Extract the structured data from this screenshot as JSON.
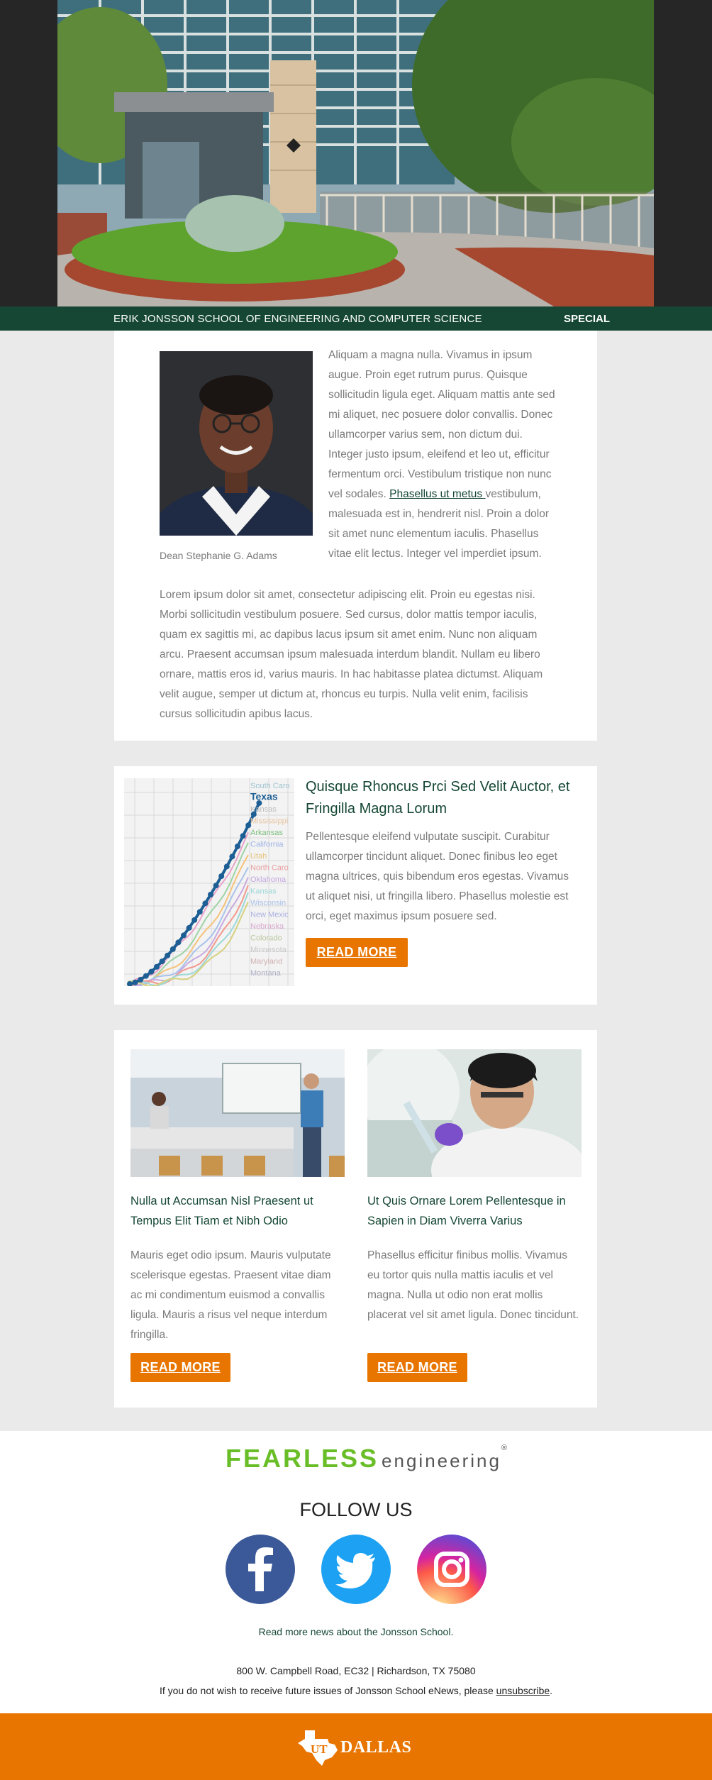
{
  "header": {
    "school_name": "ERIK JONSSON SCHOOL OF ENGINEERING AND COMPUTER SCIENCE",
    "edition_label": "SPECIAL"
  },
  "dean_section": {
    "caption": "Dean Stephanie G. Adams",
    "para1_before_link": "Aliquam a magna nulla. Vivamus in ipsum augue. Proin eget rutrum purus. Quisque sollicitudin ligula eget. Aliquam mattis ante sed mi aliquet, nec posuere dolor convallis. Donec ullamcorper varius sem, non dictum dui. Integer justo ipsum, eleifend et leo ut, efficitur fermentum orci. Vestibulum tristique non nunc vel sodales.",
    "link_text": "Phasellus ut metus ",
    "para1_after_link": "vestibulum, malesuada est in, hendrerit nisl. Proin a dolor sit amet nunc elementum iaculis. Phasellus vitae elit lectus. Integer vel imperdiet ipsum.",
    "para2": "Lorem ipsum dolor sit amet, consectetur adipiscing elit. Proin eu egestas nisi. Morbi sollicitudin vestibulum posuere. Sed cursus, dolor mattis tempor iaculis, quam ex sagittis mi, ac dapibus lacus ipsum sit amet enim. Nunc non aliquam arcu. Praesent accumsan ipsum malesuada interdum blandit. Nullam eu libero ornare, mattis eros id, varius mauris. In hac habitasse platea dictumst. Aliquam velit augue, semper ut dictum at, rhoncus eu turpis. Nulla velit enim, facilisis cursus sollicitudin apibus lacus."
  },
  "feature": {
    "title": "Quisque Rhoncus Prci Sed Velit Auctor, et Fringilla Magna Lorum",
    "body": "Pellentesque eleifend vulputate suscipit. Curabitur ullamcorper tincidunt aliquet. Donec finibus leo eget magna ultrices, quis bibendum eros egestas. Vivamus ut aliquet nisi, ut fringilla libero. Phasellus molestie est orci, eget maximus ipsum posuere sed.",
    "button": "READ MORE",
    "image_labels": [
      "South Caro",
      "Texas",
      "Kansas",
      "Mississippi",
      "Arkansas",
      "California",
      "Utah",
      "North Caro",
      "Oklahoma",
      "Kansas",
      "Wisconsin",
      "New Mexic",
      "Nebraska",
      "Colorado",
      "Minnesota",
      "Maryland",
      "Montana"
    ]
  },
  "stories": [
    {
      "title": "Nulla ut Accumsan Nisl Praesent ut Tempus Elit Tiam et Nibh Odio",
      "body": "Mauris eget odio ipsum. Mauris vulputate scelerisque egestas. Praesent vitae diam ac mi condimentum euismod a convallis ligula. Mauris a risus vel neque interdum fringilla.",
      "button": "READ MORE"
    },
    {
      "title": "Ut Quis Ornare Lorem Pellentesque in Sapien in Diam Viverra Varius",
      "body": "Phasellus efficitur finibus mollis. Vivamus eu tortor quis nulla mattis iaculis et vel magna. Nulla ut odio non erat mollis placerat vel sit amet ligula. Donec tincidunt.",
      "button": "READ MORE"
    }
  ],
  "footer": {
    "brand_bold": "FEARLESS",
    "brand_light": "engineering",
    "registered": "®",
    "follow_us": "FOLLOW US",
    "social": [
      "facebook-icon",
      "twitter-icon",
      "instagram-icon"
    ],
    "more_news": "Read more news about the Jonsson School.",
    "address": "800 W. Campbell Road, EC32 | Richardson, TX 75080",
    "unsubscribe_before": "If you do not wish to receive future issues of Jonsson School eNews, please ",
    "unsubscribe_link": "unsubscribe",
    "unsubscribe_after": ".",
    "logo_ut": "UT",
    "logo_dallas": "DALLAS"
  },
  "colors": {
    "brand_green": "#154734",
    "accent_orange": "#e87500",
    "fearless_green": "#69be28",
    "page_bg": "#eaeaea"
  }
}
